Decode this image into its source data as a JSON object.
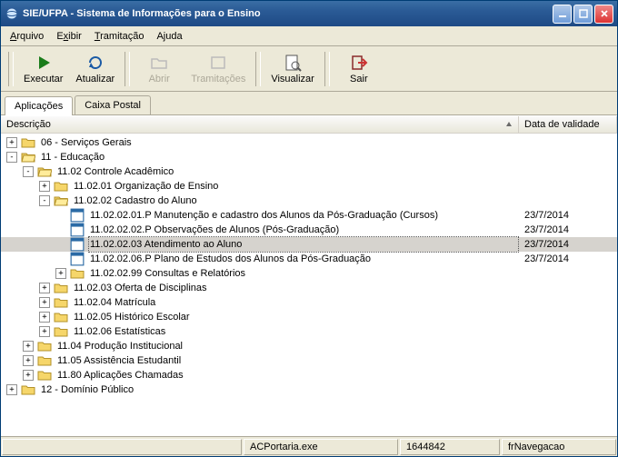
{
  "window": {
    "title": "SIE/UFPA - Sistema de Informações para o Ensino"
  },
  "menu": {
    "file": "Arquivo",
    "show": "Exibir",
    "tram": "Tramitação",
    "help": "Ajuda"
  },
  "toolbar": {
    "exec": "Executar",
    "refresh": "Atualizar",
    "open": "Abrir",
    "trams": "Tramitações",
    "view": "Visualizar",
    "exit": "Sair"
  },
  "tabs": {
    "app": "Aplicações",
    "mail": "Caixa Postal"
  },
  "cols": {
    "desc": "Descrição",
    "date": "Data de validade"
  },
  "tree": [
    {
      "lvl": 0,
      "tg": "+",
      "ic": "folder",
      "lbl": "06 - Serviços Gerais"
    },
    {
      "lvl": 0,
      "tg": "-",
      "ic": "folder-open",
      "lbl": "11 - Educação"
    },
    {
      "lvl": 1,
      "tg": "-",
      "ic": "folder-open",
      "lbl": "11.02 Controle Acadêmico"
    },
    {
      "lvl": 2,
      "tg": "+",
      "ic": "folder",
      "lbl": "11.02.01 Organização de Ensino"
    },
    {
      "lvl": 2,
      "tg": "-",
      "ic": "folder-open",
      "lbl": "11.02.02 Cadastro do Aluno"
    },
    {
      "lvl": 3,
      "tg": "",
      "ic": "file",
      "lbl": "11.02.02.01.P Manutenção e cadastro dos Alunos da Pós-Graduação (Cursos)",
      "dt": "23/7/2014"
    },
    {
      "lvl": 3,
      "tg": "",
      "ic": "file",
      "lbl": "11.02.02.02.P Observações de Alunos (Pós-Graduação)",
      "dt": "23/7/2014"
    },
    {
      "lvl": 3,
      "tg": "",
      "ic": "file",
      "lbl": "11.02.02.03 Atendimento ao Aluno",
      "dt": "23/7/2014",
      "sel": true
    },
    {
      "lvl": 3,
      "tg": "",
      "ic": "file",
      "lbl": "11.02.02.06.P Plano de Estudos dos Alunos da Pós-Graduação",
      "dt": "23/7/2014"
    },
    {
      "lvl": 3,
      "tg": "+",
      "ic": "folder",
      "lbl": "11.02.02.99 Consultas e Relatórios"
    },
    {
      "lvl": 2,
      "tg": "+",
      "ic": "folder",
      "lbl": "11.02.03 Oferta de Disciplinas"
    },
    {
      "lvl": 2,
      "tg": "+",
      "ic": "folder",
      "lbl": "11.02.04 Matrícula"
    },
    {
      "lvl": 2,
      "tg": "+",
      "ic": "folder",
      "lbl": "11.02.05 Histórico Escolar"
    },
    {
      "lvl": 2,
      "tg": "+",
      "ic": "folder",
      "lbl": "11.02.06 Estatísticas"
    },
    {
      "lvl": 1,
      "tg": "+",
      "ic": "folder",
      "lbl": "11.04 Produção Institucional"
    },
    {
      "lvl": 1,
      "tg": "+",
      "ic": "folder",
      "lbl": "11.05  Assistência Estudantil"
    },
    {
      "lvl": 1,
      "tg": "+",
      "ic": "folder",
      "lbl": "11.80 Aplicações Chamadas"
    },
    {
      "lvl": 0,
      "tg": "+",
      "ic": "folder",
      "lbl": "12 - Domínio Público"
    }
  ],
  "status": {
    "exe": "ACPortaria.exe",
    "num": "1644842",
    "form": "frNavegacao"
  }
}
